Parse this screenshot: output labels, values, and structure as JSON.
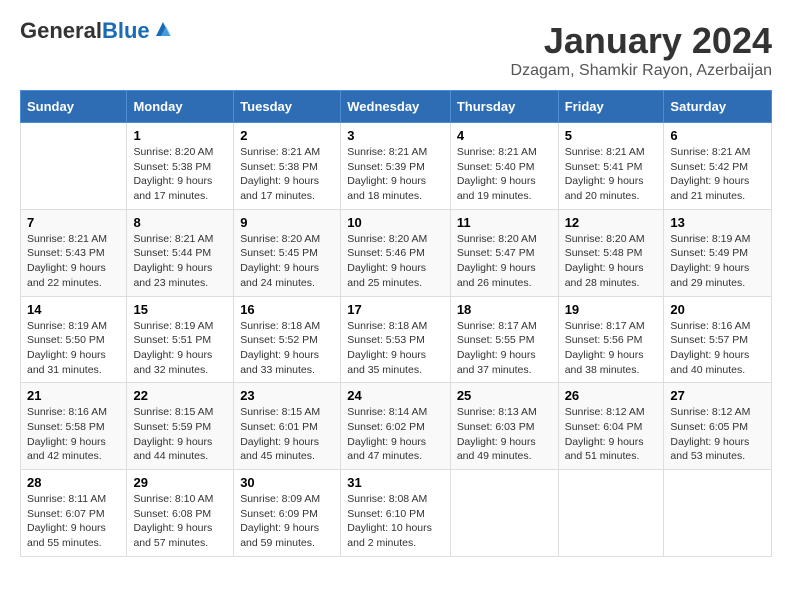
{
  "header": {
    "logo_general": "General",
    "logo_blue": "Blue",
    "title": "January 2024",
    "subtitle": "Dzagam, Shamkir Rayon, Azerbaijan"
  },
  "weekdays": [
    "Sunday",
    "Monday",
    "Tuesday",
    "Wednesday",
    "Thursday",
    "Friday",
    "Saturday"
  ],
  "weeks": [
    [
      {
        "day": "",
        "info": ""
      },
      {
        "day": "1",
        "info": "Sunrise: 8:20 AM\nSunset: 5:38 PM\nDaylight: 9 hours\nand 17 minutes."
      },
      {
        "day": "2",
        "info": "Sunrise: 8:21 AM\nSunset: 5:38 PM\nDaylight: 9 hours\nand 17 minutes."
      },
      {
        "day": "3",
        "info": "Sunrise: 8:21 AM\nSunset: 5:39 PM\nDaylight: 9 hours\nand 18 minutes."
      },
      {
        "day": "4",
        "info": "Sunrise: 8:21 AM\nSunset: 5:40 PM\nDaylight: 9 hours\nand 19 minutes."
      },
      {
        "day": "5",
        "info": "Sunrise: 8:21 AM\nSunset: 5:41 PM\nDaylight: 9 hours\nand 20 minutes."
      },
      {
        "day": "6",
        "info": "Sunrise: 8:21 AM\nSunset: 5:42 PM\nDaylight: 9 hours\nand 21 minutes."
      }
    ],
    [
      {
        "day": "7",
        "info": "Sunrise: 8:21 AM\nSunset: 5:43 PM\nDaylight: 9 hours\nand 22 minutes."
      },
      {
        "day": "8",
        "info": "Sunrise: 8:21 AM\nSunset: 5:44 PM\nDaylight: 9 hours\nand 23 minutes."
      },
      {
        "day": "9",
        "info": "Sunrise: 8:20 AM\nSunset: 5:45 PM\nDaylight: 9 hours\nand 24 minutes."
      },
      {
        "day": "10",
        "info": "Sunrise: 8:20 AM\nSunset: 5:46 PM\nDaylight: 9 hours\nand 25 minutes."
      },
      {
        "day": "11",
        "info": "Sunrise: 8:20 AM\nSunset: 5:47 PM\nDaylight: 9 hours\nand 26 minutes."
      },
      {
        "day": "12",
        "info": "Sunrise: 8:20 AM\nSunset: 5:48 PM\nDaylight: 9 hours\nand 28 minutes."
      },
      {
        "day": "13",
        "info": "Sunrise: 8:19 AM\nSunset: 5:49 PM\nDaylight: 9 hours\nand 29 minutes."
      }
    ],
    [
      {
        "day": "14",
        "info": "Sunrise: 8:19 AM\nSunset: 5:50 PM\nDaylight: 9 hours\nand 31 minutes."
      },
      {
        "day": "15",
        "info": "Sunrise: 8:19 AM\nSunset: 5:51 PM\nDaylight: 9 hours\nand 32 minutes."
      },
      {
        "day": "16",
        "info": "Sunrise: 8:18 AM\nSunset: 5:52 PM\nDaylight: 9 hours\nand 33 minutes."
      },
      {
        "day": "17",
        "info": "Sunrise: 8:18 AM\nSunset: 5:53 PM\nDaylight: 9 hours\nand 35 minutes."
      },
      {
        "day": "18",
        "info": "Sunrise: 8:17 AM\nSunset: 5:55 PM\nDaylight: 9 hours\nand 37 minutes."
      },
      {
        "day": "19",
        "info": "Sunrise: 8:17 AM\nSunset: 5:56 PM\nDaylight: 9 hours\nand 38 minutes."
      },
      {
        "day": "20",
        "info": "Sunrise: 8:16 AM\nSunset: 5:57 PM\nDaylight: 9 hours\nand 40 minutes."
      }
    ],
    [
      {
        "day": "21",
        "info": "Sunrise: 8:16 AM\nSunset: 5:58 PM\nDaylight: 9 hours\nand 42 minutes."
      },
      {
        "day": "22",
        "info": "Sunrise: 8:15 AM\nSunset: 5:59 PM\nDaylight: 9 hours\nand 44 minutes."
      },
      {
        "day": "23",
        "info": "Sunrise: 8:15 AM\nSunset: 6:01 PM\nDaylight: 9 hours\nand 45 minutes."
      },
      {
        "day": "24",
        "info": "Sunrise: 8:14 AM\nSunset: 6:02 PM\nDaylight: 9 hours\nand 47 minutes."
      },
      {
        "day": "25",
        "info": "Sunrise: 8:13 AM\nSunset: 6:03 PM\nDaylight: 9 hours\nand 49 minutes."
      },
      {
        "day": "26",
        "info": "Sunrise: 8:12 AM\nSunset: 6:04 PM\nDaylight: 9 hours\nand 51 minutes."
      },
      {
        "day": "27",
        "info": "Sunrise: 8:12 AM\nSunset: 6:05 PM\nDaylight: 9 hours\nand 53 minutes."
      }
    ],
    [
      {
        "day": "28",
        "info": "Sunrise: 8:11 AM\nSunset: 6:07 PM\nDaylight: 9 hours\nand 55 minutes."
      },
      {
        "day": "29",
        "info": "Sunrise: 8:10 AM\nSunset: 6:08 PM\nDaylight: 9 hours\nand 57 minutes."
      },
      {
        "day": "30",
        "info": "Sunrise: 8:09 AM\nSunset: 6:09 PM\nDaylight: 9 hours\nand 59 minutes."
      },
      {
        "day": "31",
        "info": "Sunrise: 8:08 AM\nSunset: 6:10 PM\nDaylight: 10 hours\nand 2 minutes."
      },
      {
        "day": "",
        "info": ""
      },
      {
        "day": "",
        "info": ""
      },
      {
        "day": "",
        "info": ""
      }
    ]
  ]
}
